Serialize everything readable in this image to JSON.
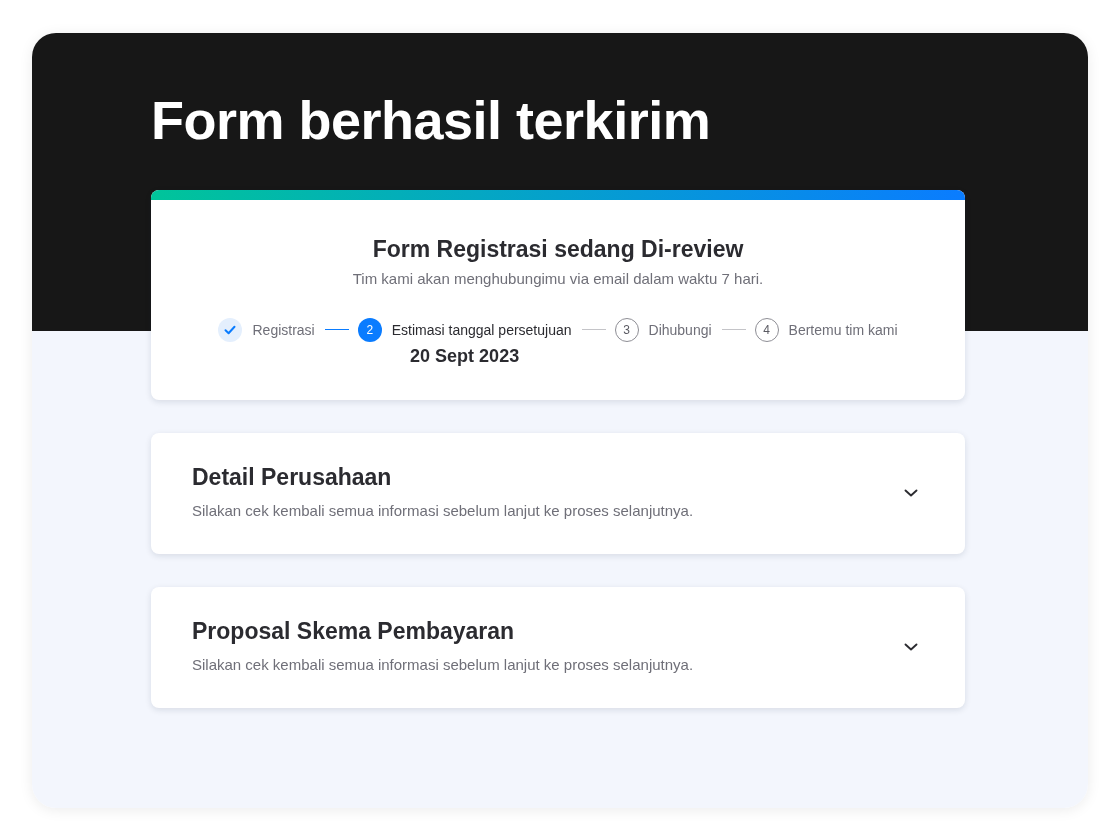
{
  "page": {
    "title": "Form berhasil terkirim"
  },
  "status_card": {
    "title": "Form Registrasi sedang Di-review",
    "subtitle": "Tim kami akan menghubungimu via email dalam waktu 7 hari.",
    "steps": [
      {
        "label": "Registrasi",
        "completed": true,
        "active": false
      },
      {
        "number": "2",
        "label": "Estimasi tanggal persetujuan",
        "completed": false,
        "active": true,
        "detail": "20 Sept 2023"
      },
      {
        "number": "3",
        "label": "Dihubungi",
        "completed": false,
        "active": false
      },
      {
        "number": "4",
        "label": "Bertemu tim kami",
        "completed": false,
        "active": false
      }
    ]
  },
  "sections": [
    {
      "title": "Detail Perusahaan",
      "description": "Silakan cek kembali semua informasi sebelum lanjut ke proses selanjutnya.",
      "expanded": false
    },
    {
      "title": "Proposal Skema Pembayaran",
      "description": "Silakan cek kembali semua informasi sebelum lanjut ke proses selanjutnya.",
      "expanded": false
    }
  ]
}
